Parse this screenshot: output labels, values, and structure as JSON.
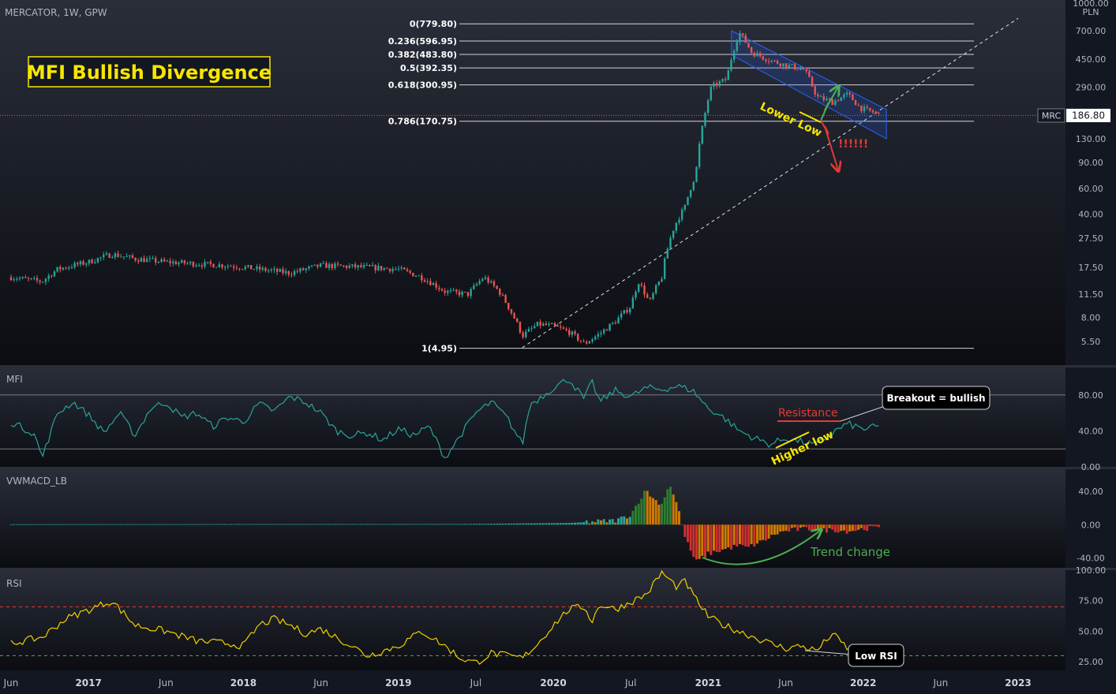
{
  "header": {
    "symbol_line": "MERCATOR, 1W, GPW",
    "currency": "PLN",
    "top_price_label": "1000.00"
  },
  "headline": "MFI Bullish Divergence",
  "colors": {
    "bg": "#131722",
    "panel_sep": "#2a2e39",
    "axis_text": "#b2b5be",
    "up": "#26a69a",
    "down": "#ef5350",
    "mfi": "#26a69a",
    "rsi": "#f0d000",
    "headline_text": "#f7e600",
    "annotation_green": "#4caf50",
    "annotation_red": "#e53935"
  },
  "price_panel": {
    "y_scale": "log",
    "ylim": [
      4.2,
      1000
    ],
    "ticks": [
      "1000.00",
      "700.00",
      "450.00",
      "290.00",
      "190.00",
      "130.00",
      "90.00",
      "60.00",
      "40.00",
      "27.50",
      "17.50",
      "11.50",
      "8.00",
      "5.50"
    ],
    "last_price": "186.80",
    "ticker_tag": "MRC",
    "fib_levels": [
      {
        "label": "0(779.80)",
        "value": 779.8
      },
      {
        "label": "0.236(596.95)",
        "value": 596.95
      },
      {
        "label": "0.382(483.80)",
        "value": 483.8
      },
      {
        "label": "0.5(392.35)",
        "value": 392.35
      },
      {
        "label": "0.618(300.95)",
        "value": 300.95
      },
      {
        "label": "0.786(170.75)",
        "value": 170.75
      },
      {
        "label": "1(4.95)",
        "value": 4.95
      }
    ],
    "annotations": {
      "lower_low": "Lower Low",
      "warning": "!!!!!!"
    }
  },
  "mfi_panel": {
    "title": "MFI",
    "ticks": [
      "80.00",
      "40.00",
      "0.00"
    ],
    "ylim": [
      0,
      100
    ],
    "bands": [
      80,
      20
    ],
    "annotations": {
      "resistance": "Resistance",
      "higher_low": "Higher low",
      "callout": "Breakout = bullish"
    }
  },
  "vwmacd_panel": {
    "title": "VWMACD_LB",
    "ticks": [
      "40.00",
      "0.00",
      "-40.00"
    ],
    "ylim": [
      -52,
      62
    ],
    "annotations": {
      "trend_change": "Trend change"
    }
  },
  "rsi_panel": {
    "title": "RSI",
    "ticks": [
      "100.00",
      "75.00",
      "50.00",
      "25.00"
    ],
    "ylim": [
      18,
      100
    ],
    "bands": [
      70,
      30
    ],
    "annotations": {
      "callout": "Low RSI"
    }
  },
  "time_axis": {
    "labels": [
      {
        "text": "Jun",
        "t": 0.0
      },
      {
        "text": "2017",
        "t": 0.5
      },
      {
        "text": "Jun",
        "t": 1.0
      },
      {
        "text": "2018",
        "t": 1.5
      },
      {
        "text": "Jun",
        "t": 2.0
      },
      {
        "text": "2019",
        "t": 2.5
      },
      {
        "text": "Jul",
        "t": 3.0
      },
      {
        "text": "2020",
        "t": 3.5
      },
      {
        "text": "Jul",
        "t": 4.0
      },
      {
        "text": "2021",
        "t": 4.5
      },
      {
        "text": "Jun",
        "t": 5.0
      },
      {
        "text": "2022",
        "t": 5.5
      },
      {
        "text": "Jun",
        "t": 6.0
      },
      {
        "text": "2023",
        "t": 6.5
      }
    ]
  },
  "chart_data": [
    {
      "type": "candlestick",
      "yscale": "log",
      "anchors": [
        [
          0.0,
          15
        ],
        [
          0.2,
          14
        ],
        [
          0.3,
          17
        ],
        [
          0.5,
          19
        ],
        [
          0.65,
          21.5
        ],
        [
          0.8,
          20
        ],
        [
          1.0,
          19
        ],
        [
          1.2,
          18.5
        ],
        [
          1.4,
          18
        ],
        [
          1.6,
          17
        ],
        [
          1.8,
          16
        ],
        [
          2.0,
          18
        ],
        [
          2.3,
          17.5
        ],
        [
          2.5,
          17
        ],
        [
          2.65,
          15
        ],
        [
          2.8,
          12
        ],
        [
          2.95,
          11.5
        ],
        [
          3.05,
          15
        ],
        [
          3.15,
          12
        ],
        [
          3.22,
          9
        ],
        [
          3.3,
          6
        ],
        [
          3.4,
          7.2
        ],
        [
          3.5,
          7.0
        ],
        [
          3.6,
          6.4
        ],
        [
          3.7,
          5.3
        ],
        [
          3.8,
          6.2
        ],
        [
          3.9,
          7.5
        ],
        [
          4.0,
          9.5
        ],
        [
          4.05,
          14
        ],
        [
          4.12,
          10
        ],
        [
          4.2,
          15
        ],
        [
          4.28,
          33
        ],
        [
          4.35,
          45
        ],
        [
          4.42,
          75
        ],
        [
          4.47,
          170
        ],
        [
          4.52,
          290
        ],
        [
          4.62,
          330
        ],
        [
          4.7,
          680
        ],
        [
          4.78,
          500
        ],
        [
          4.9,
          440
        ],
        [
          5.0,
          410
        ],
        [
          5.12,
          380
        ],
        [
          5.2,
          250
        ],
        [
          5.3,
          230
        ],
        [
          5.4,
          260
        ],
        [
          5.48,
          210
        ],
        [
          5.6,
          190
        ]
      ]
    },
    {
      "type": "line",
      "name": "MFI",
      "anchors": [
        [
          0.0,
          50
        ],
        [
          0.15,
          37
        ],
        [
          0.2,
          10
        ],
        [
          0.3,
          60
        ],
        [
          0.4,
          72
        ],
        [
          0.5,
          58
        ],
        [
          0.6,
          38
        ],
        [
          0.7,
          60
        ],
        [
          0.8,
          35
        ],
        [
          0.9,
          65
        ],
        [
          1.0,
          72
        ],
        [
          1.1,
          55
        ],
        [
          1.2,
          60
        ],
        [
          1.3,
          45
        ],
        [
          1.4,
          55
        ],
        [
          1.5,
          50
        ],
        [
          1.6,
          70
        ],
        [
          1.7,
          62
        ],
        [
          1.8,
          78
        ],
        [
          1.9,
          72
        ],
        [
          2.0,
          60
        ],
        [
          2.1,
          40
        ],
        [
          2.2,
          35
        ],
        [
          2.3,
          38
        ],
        [
          2.4,
          30
        ],
        [
          2.5,
          42
        ],
        [
          2.6,
          35
        ],
        [
          2.7,
          45
        ],
        [
          2.8,
          10
        ],
        [
          2.9,
          35
        ],
        [
          3.0,
          60
        ],
        [
          3.1,
          72
        ],
        [
          3.2,
          55
        ],
        [
          3.3,
          25
        ],
        [
          3.35,
          70
        ],
        [
          3.4,
          75
        ],
        [
          3.5,
          88
        ],
        [
          3.6,
          98
        ],
        [
          3.7,
          75
        ],
        [
          3.75,
          95
        ],
        [
          3.8,
          72
        ],
        [
          3.9,
          85
        ],
        [
          4.0,
          78
        ],
        [
          4.1,
          88
        ],
        [
          4.2,
          86
        ],
        [
          4.3,
          90
        ],
        [
          4.4,
          85
        ],
        [
          4.5,
          65
        ],
        [
          4.6,
          55
        ],
        [
          4.7,
          40
        ],
        [
          4.8,
          32
        ],
        [
          4.9,
          25
        ],
        [
          5.0,
          32
        ],
        [
          5.1,
          28
        ],
        [
          5.2,
          24
        ],
        [
          5.3,
          38
        ],
        [
          5.4,
          48
        ],
        [
          5.5,
          42
        ],
        [
          5.6,
          45
        ]
      ]
    },
    {
      "type": "bar",
      "name": "VWMACD_LB",
      "anchors": [
        [
          0.0,
          0.5
        ],
        [
          2.9,
          0.8
        ],
        [
          3.6,
          2
        ],
        [
          3.9,
          5
        ],
        [
          4.0,
          12
        ],
        [
          4.05,
          28
        ],
        [
          4.1,
          42
        ],
        [
          4.15,
          30
        ],
        [
          4.2,
          25
        ],
        [
          4.25,
          50
        ],
        [
          4.27,
          38
        ],
        [
          4.3,
          24
        ],
        [
          4.33,
          0
        ],
        [
          4.36,
          -20
        ],
        [
          4.42,
          -45
        ],
        [
          4.5,
          -35
        ],
        [
          4.6,
          -30
        ],
        [
          4.7,
          -25
        ],
        [
          4.75,
          -28
        ],
        [
          4.85,
          -20
        ],
        [
          4.95,
          -10
        ],
        [
          5.05,
          -6
        ],
        [
          5.15,
          -5
        ],
        [
          5.25,
          -7
        ],
        [
          5.3,
          -6
        ],
        [
          5.4,
          -8
        ],
        [
          5.5,
          -5
        ],
        [
          5.6,
          -3
        ]
      ]
    },
    {
      "type": "line",
      "name": "RSI",
      "anchors": [
        [
          0.0,
          40
        ],
        [
          0.2,
          45
        ],
        [
          0.35,
          60
        ],
        [
          0.55,
          70
        ],
        [
          0.65,
          75
        ],
        [
          0.8,
          55
        ],
        [
          1.0,
          50
        ],
        [
          1.2,
          42
        ],
        [
          1.4,
          40
        ],
        [
          1.5,
          38
        ],
        [
          1.6,
          55
        ],
        [
          1.7,
          60
        ],
        [
          1.8,
          55
        ],
        [
          1.9,
          48
        ],
        [
          2.0,
          52
        ],
        [
          2.1,
          45
        ],
        [
          2.2,
          38
        ],
        [
          2.3,
          30
        ],
        [
          2.5,
          38
        ],
        [
          2.65,
          50
        ],
        [
          2.8,
          38
        ],
        [
          2.9,
          28
        ],
        [
          3.0,
          24
        ],
        [
          3.1,
          32
        ],
        [
          3.2,
          30
        ],
        [
          3.3,
          28
        ],
        [
          3.4,
          40
        ],
        [
          3.5,
          55
        ],
        [
          3.6,
          68
        ],
        [
          3.7,
          70
        ],
        [
          3.75,
          58
        ],
        [
          3.8,
          72
        ],
        [
          3.9,
          68
        ],
        [
          4.0,
          74
        ],
        [
          4.1,
          80
        ],
        [
          4.2,
          98
        ],
        [
          4.3,
          86
        ],
        [
          4.35,
          91
        ],
        [
          4.4,
          80
        ],
        [
          4.5,
          62
        ],
        [
          4.6,
          55
        ],
        [
          4.7,
          50
        ],
        [
          4.8,
          45
        ],
        [
          4.9,
          40
        ],
        [
          5.0,
          36
        ],
        [
          5.1,
          38
        ],
        [
          5.2,
          34
        ],
        [
          5.3,
          48
        ],
        [
          5.4,
          36
        ],
        [
          5.5,
          32
        ],
        [
          5.6,
          32
        ]
      ]
    }
  ]
}
